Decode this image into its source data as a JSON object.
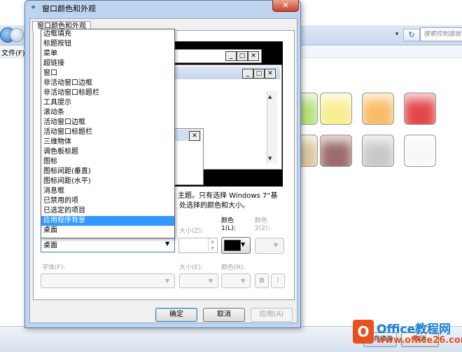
{
  "dialog": {
    "title": "窗口颜色和外观",
    "close_glyph": "✕",
    "tab_label": "窗口颜色和外观"
  },
  "item_list": {
    "items": [
      "边框填充",
      "标题按钮",
      "菜单",
      "超链接",
      "窗口",
      "非活动窗口边框",
      "非活动窗口标题栏",
      "工具提示",
      "滚动条",
      "活动窗口边框",
      "活动窗口标题栏",
      "三维物体",
      "调色板标题",
      "图标",
      "图标间距(垂直)",
      "图标间距(水平)",
      "消息框",
      "已禁用的项",
      "已选定的项目",
      "应用程序背景",
      "桌面"
    ],
    "selected_index": 19
  },
  "preview": {
    "close_glyph": "✕",
    "min_glyph": "_",
    "max_glyph": "□"
  },
  "description": {
    "line1": "主题。只有选择 Windows 7“基",
    "line2": "处选择的颜色和大小。"
  },
  "item": {
    "combo_value": "桌面",
    "size_label": "大小(Z):",
    "color1_label_a": "颜色",
    "color1_label_b": "1(L):",
    "color2_label_a": "颜色",
    "color2_label_b": "2(2):",
    "color1_value": "#000000"
  },
  "font": {
    "font_label": "字体(F):",
    "size_label": "大小(E):",
    "color_label": "颜色(R):",
    "bold_label": "B",
    "italic_label": "I"
  },
  "buttons": {
    "ok": "确定",
    "cancel": "取消",
    "apply": "应用(A)"
  },
  "background_window": {
    "menu_file": "文件(F)",
    "search_placeholder": "搜索控制面板",
    "refresh_glyph": "↻",
    "dropdown_glyph": "▾",
    "save_label": "保存修改",
    "cancel_label": "取消",
    "swatch_colors": [
      "#b6e07a",
      "#f7ee92",
      "#f9bd6a",
      "#e24848",
      "#f0f0f0",
      "#d7c5a0",
      "#9c6b6b",
      "#c9c9c9",
      "#d9d9d9",
      "#f8f8f8"
    ]
  },
  "watermark": {
    "logo_letter": "O",
    "line1": "Office教程网",
    "line2": "www.office26.com"
  }
}
